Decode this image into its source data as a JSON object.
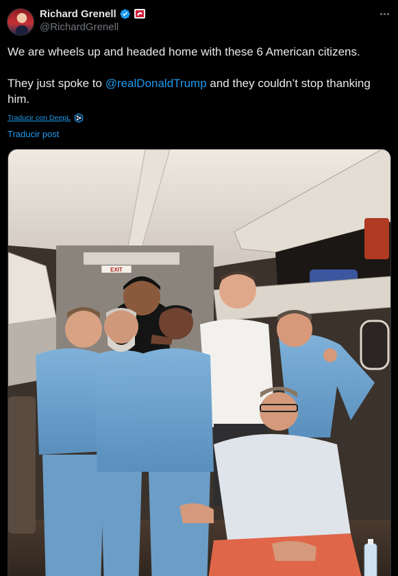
{
  "author": {
    "display_name": "Richard Grenell",
    "handle": "@RichardGrenell",
    "avatar_icon": "profile-photo",
    "verified_icon": "verified-badge-icon",
    "affiliation_icon": "affiliation-badge-icon"
  },
  "tweet": {
    "line1": "We are wheels up and headed home with these 6 American citizens.",
    "line2_before": "They just spoke to ",
    "mention": "@realDonaldTrump",
    "line2_after": " and they couldn’t stop thanking him."
  },
  "translate": {
    "deepl_label": "Traducir con DeepL",
    "post_label": "Traducir post"
  },
  "photo_text": {
    "exit_sign": "EXIT"
  },
  "colors": {
    "background": "#000000",
    "text": "#e7e9ea",
    "muted": "#71767b",
    "link": "#1d9bf0"
  }
}
